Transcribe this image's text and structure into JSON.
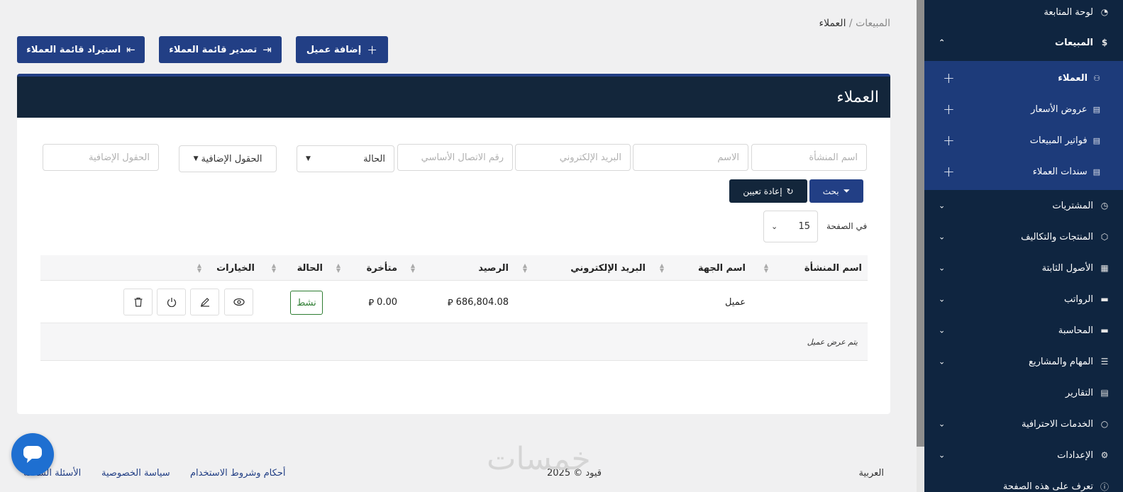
{
  "sidebar": {
    "dashboard": "لوحة المتابعة",
    "sales": "المبيعات",
    "sales_sub": [
      {
        "label": "العملاء"
      },
      {
        "label": "عروض الأسعار"
      },
      {
        "label": "فواتير المبيعات"
      },
      {
        "label": "سندات العملاء"
      }
    ],
    "items": [
      {
        "label": "المشتريات"
      },
      {
        "label": "المنتجات والتكاليف"
      },
      {
        "label": "الأصول الثابتة"
      },
      {
        "label": "الرواتب"
      },
      {
        "label": "المحاسبة"
      },
      {
        "label": "المهام والمشاريع"
      },
      {
        "label": "التقارير"
      },
      {
        "label": "الخدمات الاحترافية"
      },
      {
        "label": "الإعدادات"
      },
      {
        "label": "تعرف على هذه الصفحة"
      }
    ]
  },
  "breadcrumb": {
    "parent": "المبيعات",
    "separator": " / ",
    "current": "العملاء"
  },
  "buttons": {
    "add": "إضافة عميل",
    "export": "تصدير قائمة العملاء",
    "import": "استيراد قائمة العملاء",
    "search": "بحث",
    "reset": "إعادة تعيين"
  },
  "panel": {
    "title": "العملاء"
  },
  "filters": {
    "org_name": "اسم المنشأة",
    "name": "الاسم",
    "email": "البريد الإلكتروني",
    "phone": "رقم الاتصال الأساسي",
    "status": "الحالة",
    "extra_select": "الحقول الإضافية",
    "extra_input": "الحقول الإضافية"
  },
  "per_page": {
    "label": "في الصفحة",
    "value": "15"
  },
  "table": {
    "headers": {
      "org": "اسم المنشأة",
      "entity": "اسم الجهة",
      "email": "البريد الإلكتروني",
      "balance": "الرصيد",
      "overdue": "متأخرة",
      "status": "الحالة",
      "options": "الخيارات"
    },
    "rows": [
      {
        "org": "",
        "entity": "عميل",
        "email": "",
        "balance": "686,804.08",
        "overdue": "0.00",
        "status": "نشط"
      }
    ],
    "currency_symbol": "⃁",
    "footer": "يتم عرض عميل"
  },
  "footer": {
    "language": "العربية",
    "copyright": "قيود © 2025",
    "terms": "أحكام وشروط الاستخدام",
    "privacy": "سياسة الخصوصية",
    "faq": "الأسئلة الشائعة"
  },
  "watermark": "خمسات",
  "colors": {
    "primary": "#223f85",
    "dark": "#13263b",
    "sidebar": "#0f2540",
    "active_sub": "#1d3b7a",
    "success": "#2e7d32"
  }
}
